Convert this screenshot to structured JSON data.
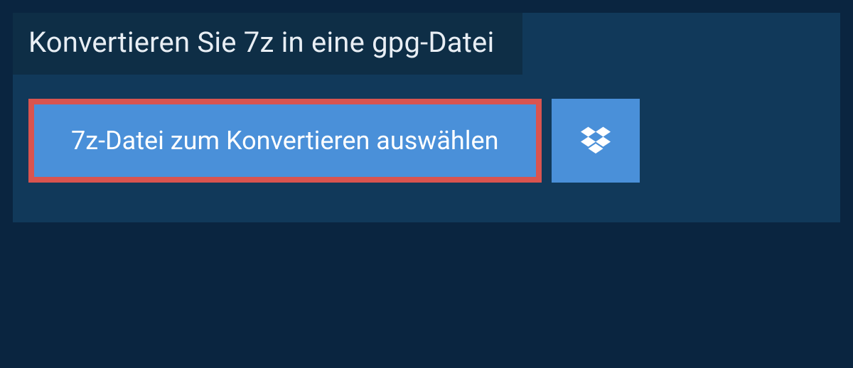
{
  "panel": {
    "title": "Konvertieren Sie 7z in eine gpg-Datei",
    "select_button_label": "7z-Datei zum Konvertieren auswählen",
    "dropbox_icon": "dropbox-icon"
  },
  "colors": {
    "page_bg": "#0a2540",
    "panel_bg": "#11395a",
    "title_bg": "#0e2e46",
    "button_bg": "#4a90d9",
    "highlight_border": "#d9544f",
    "text_light": "#e8eef4",
    "text_white": "#ffffff"
  }
}
